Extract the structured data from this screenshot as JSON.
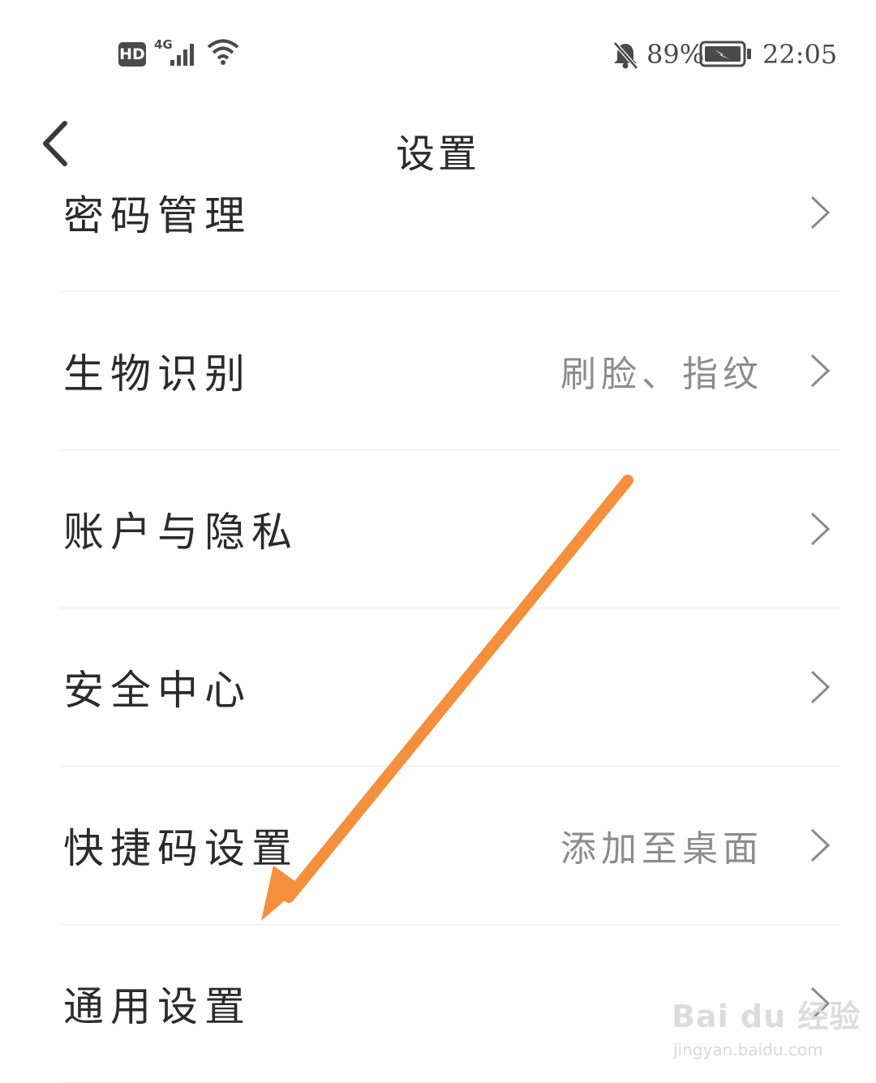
{
  "status_bar": {
    "hd_badge": "HD",
    "network_type": "4G",
    "battery_percent": "89%",
    "time": "22:05",
    "icons": [
      "hd-icon",
      "signal-icon",
      "wifi-icon",
      "bell-off-icon",
      "battery-charging-icon"
    ]
  },
  "header": {
    "title": "设置",
    "back_icon": "back-arrow-icon"
  },
  "settings": {
    "items": [
      {
        "label": "密码管理",
        "value": ""
      },
      {
        "label": "生物识别",
        "value": "刷脸、指纹"
      },
      {
        "label": "账户与隐私",
        "value": ""
      },
      {
        "label": "安全中心",
        "value": ""
      },
      {
        "label": "快捷码设置",
        "value": "添加至桌面"
      },
      {
        "label": "通用设置",
        "value": ""
      }
    ]
  },
  "annotation": {
    "color": "#F58F3C",
    "points_to": "通用设置"
  },
  "watermark": {
    "brand": "Bai du 经验",
    "url": "jingyan.baidu.com"
  }
}
